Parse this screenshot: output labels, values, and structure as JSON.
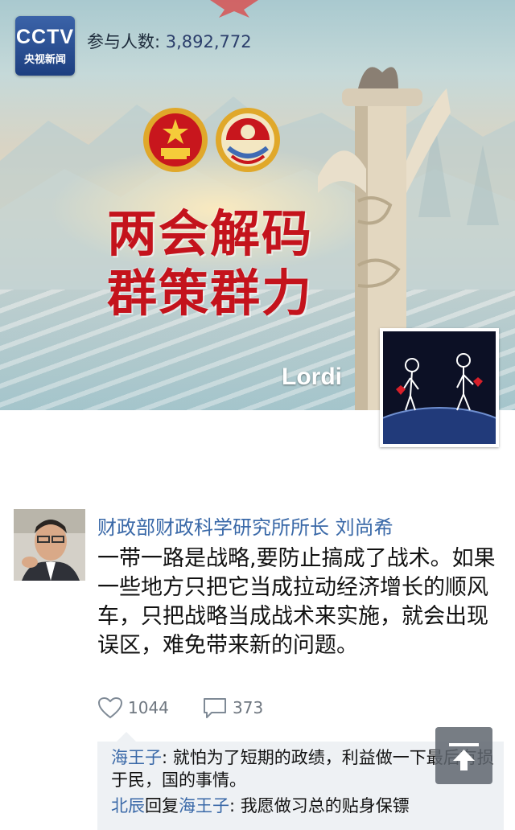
{
  "banner": {
    "logo_main": "CCTV",
    "logo_sub": "央视新闻",
    "participants_label": "参与人数: ",
    "participants_count": "3,892,772",
    "title_line1": "两会解码",
    "title_line2": "群策群力",
    "current_user_name": "Lordi"
  },
  "post": {
    "author": "财政部财政科学研究所所长 刘尚希",
    "content": "一带一路是战略,要防止搞成了战术。如果一些地方只把它当成拉动经济增长的顺风车，只把战略当成战术来实施，就会出现误区，难免带来新的问题。",
    "likes": "1044",
    "comments": "373"
  },
  "comments": [
    {
      "user": "海王子",
      "sep": ": ",
      "text": "就怕为了短期的政绩，利益做一下最后有损于民，国的事情。"
    },
    {
      "user": "北辰",
      "mid": "回复",
      "reply_to": "海王子",
      "sep": ": ",
      "text": "我愿做习总的贴身保镖"
    }
  ],
  "colors": {
    "link_blue": "#3a69a8",
    "title_red": "#c4131c",
    "logo_blue": "#1d3f80"
  }
}
